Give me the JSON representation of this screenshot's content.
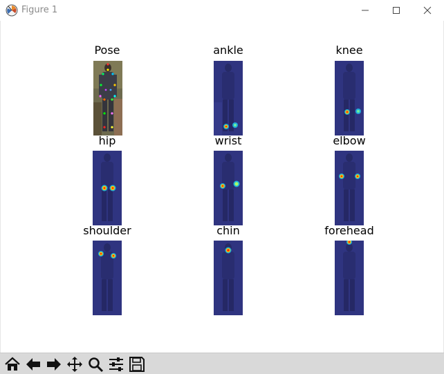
{
  "window": {
    "title": "Figure 1"
  },
  "panels": [
    {
      "title": "Pose",
      "kind": "pose"
    },
    {
      "title": "ankle",
      "kind": "heatmap"
    },
    {
      "title": "knee",
      "kind": "heatmap"
    },
    {
      "title": "hip",
      "kind": "heatmap"
    },
    {
      "title": "wrist",
      "kind": "heatmap"
    },
    {
      "title": "elbow",
      "kind": "heatmap"
    },
    {
      "title": "shoulder",
      "kind": "heatmap"
    },
    {
      "title": "chin",
      "kind": "heatmap"
    },
    {
      "title": "forehead",
      "kind": "heatmap"
    }
  ],
  "toolbar": {
    "buttons": [
      {
        "name": "home-icon"
      },
      {
        "name": "back-arrow-icon"
      },
      {
        "name": "forward-arrow-icon"
      },
      {
        "name": "pan-move-icon"
      },
      {
        "name": "zoom-magnifier-icon"
      },
      {
        "name": "configure-subplots-icon"
      },
      {
        "name": "save-floppy-icon"
      }
    ]
  },
  "colors": {
    "heatmap_tint": "#2b2f8f",
    "hot": "#ff2a00",
    "warm": "#ffd200",
    "cool": "#18e0ff",
    "toolbar_bg": "#d9d9d9"
  }
}
